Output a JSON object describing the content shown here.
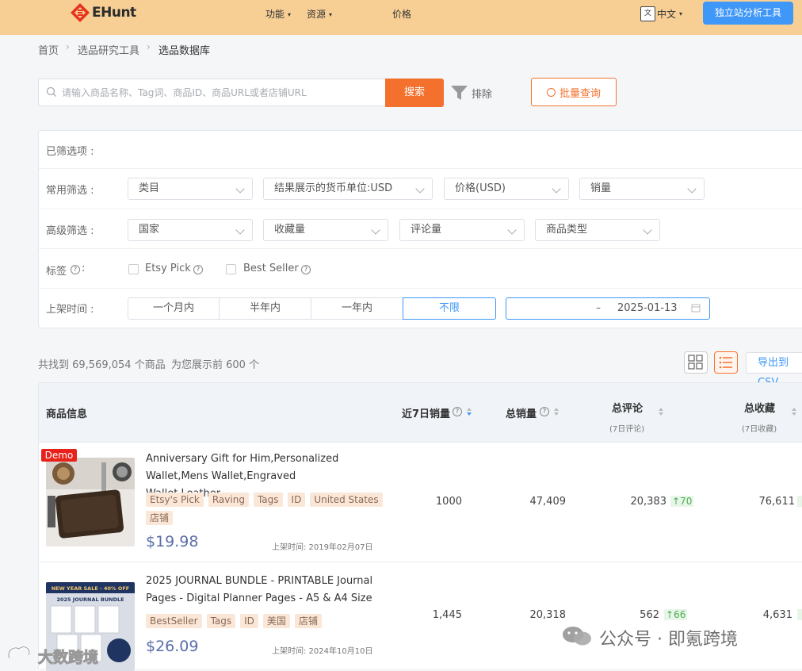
{
  "brand": {
    "name": "EHunt"
  },
  "nav": [
    {
      "label": "功能"
    },
    {
      "label": "资源"
    },
    {
      "label": "价格"
    }
  ],
  "lang": {
    "label": "中文",
    "icon": "translate-icon"
  },
  "cta": {
    "label": "独立站分析工具"
  },
  "breadcrumb": [
    "首页",
    "选品研究工具",
    "选品数据库"
  ],
  "search": {
    "placeholder": "请输入商品名称、Tag词、商品ID、商品URL或者店铺URL",
    "button": "搜索",
    "exclude": "排除",
    "batch": "批量查询"
  },
  "filters": {
    "selected_label": "已筛选项 :",
    "common_label": "常用筛选 :",
    "common": [
      "类目",
      "结果展示的货币单位:USD",
      "价格(USD)",
      "销量"
    ],
    "advanced_label": "高级筛选 :",
    "advanced": [
      "国家",
      "收藏量",
      "评论量",
      "商品类型"
    ],
    "tags_label": "标签",
    "tags_colon": ":",
    "tag_options": [
      "Etsy Pick",
      "Best Seller"
    ],
    "time_label": "上架时间 :",
    "time_options": [
      "一个月内",
      "半年内",
      "一年内",
      "不限"
    ],
    "time_active": "不限",
    "date_sep": "–",
    "date_end": "2025-01-13"
  },
  "results": {
    "found_text": "共找到 69,569,054 个商品",
    "shown_text": "为您展示前 600 个",
    "export": "导出到CSV"
  },
  "table": {
    "headers": {
      "info": "商品信息",
      "sales7": "近7日销量",
      "total_sales": "总销量",
      "reviews": "总评论",
      "reviews_sub": "(7日评论)",
      "favorites": "总收藏",
      "favorites_sub": "(7日收藏)"
    },
    "rows": [
      {
        "badge": "Demo",
        "title": "Anniversary Gift for Him,Personalized Wallet,Mens Wallet,Engraved Wallet,Leather...",
        "tags": [
          "Etsy's Pick",
          "Raving",
          "Tags",
          "ID",
          "United States",
          "店铺"
        ],
        "price": "$19.98",
        "listed": "上架时间: 2019年02月07日",
        "sales7": "1000",
        "total_sales": "47,409",
        "reviews": "20,383",
        "reviews_up": "↑70",
        "favorites": "76,611"
      },
      {
        "title": "2025 JOURNAL BUNDLE - PRINTABLE Journal Pages - Digital Planner Pages - A5 & A4 Size -...",
        "tags": [
          "BestSeller",
          "Tags",
          "ID",
          "美国",
          "店铺"
        ],
        "price": "$26.09",
        "listed": "上架时间: 2024年10月10日",
        "sales7": "1,445",
        "total_sales": "20,318",
        "reviews": "562",
        "reviews_up": "↑66",
        "favorites": "4,631",
        "thumb_banner": "NEW YEAR SALE - 40% OFF",
        "thumb_title": "2025 JOURNAL BUNDLE"
      }
    ]
  },
  "watermarks": [
    "公众号 · 即氪跨境",
    "大数跨境"
  ],
  "colors": {
    "topbar": "#f7cf95",
    "accent": "#f3712d",
    "primary": "#3f97f7",
    "price": "#5b6fa8",
    "up": "#4caf50"
  }
}
